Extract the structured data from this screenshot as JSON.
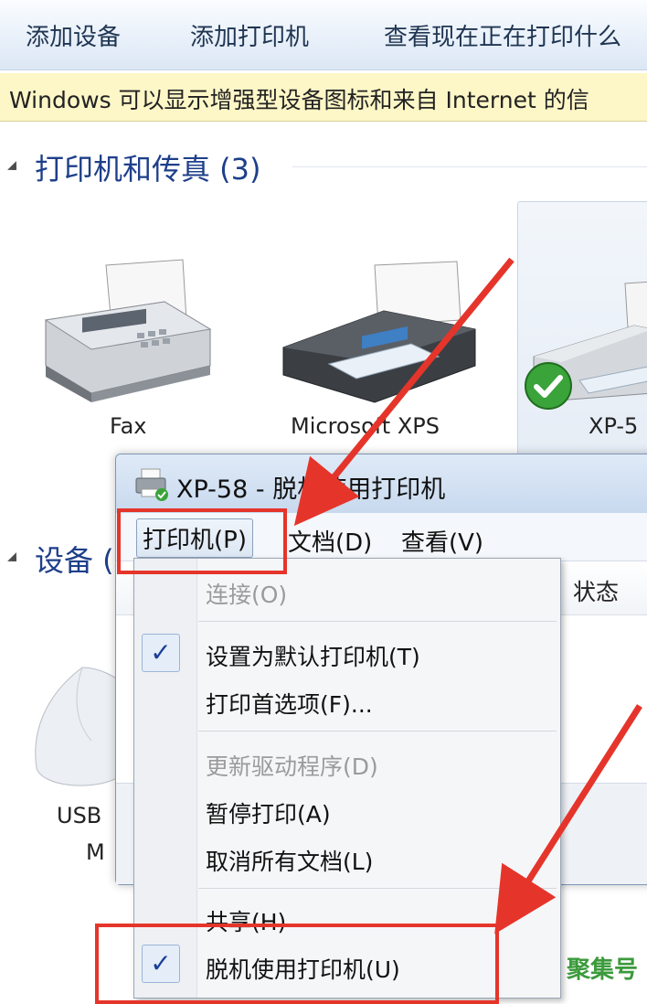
{
  "toolbar": {
    "add_device": "添加设备",
    "add_printer": "添加打印机",
    "see_printing": "查看现在正在打印什么"
  },
  "infobar": {
    "text": "Windows 可以显示增强型设备图标和来自 Internet 的信"
  },
  "printers_group": {
    "title": "打印机和传真 (3)",
    "devices": [
      {
        "label": "Fax",
        "icon": "fax-icon"
      },
      {
        "label": "Microsoft XPS",
        "icon": "printer-icon"
      },
      {
        "label": "XP-5",
        "icon": "printer-default-icon"
      }
    ]
  },
  "devices_group": {
    "title": "设备 (",
    "usb_label_1": "USB",
    "usb_label_2": "M"
  },
  "dialog": {
    "title": "XP-58  -  脱机使用打印机",
    "menu": {
      "printer": "打印机(P)",
      "document": "文档(D)",
      "view": "查看(V)"
    },
    "column_status": "状态"
  },
  "dropdown": {
    "items": [
      {
        "label": "连接(O)",
        "enabled": false,
        "checked": false
      },
      {
        "label": "设置为默认打印机(T)",
        "enabled": true,
        "checked": true
      },
      {
        "label": "打印首选项(F)...",
        "enabled": true,
        "checked": false
      },
      {
        "label": "更新驱动程序(D)",
        "enabled": false,
        "checked": false
      },
      {
        "label": "暂停打印(A)",
        "enabled": true,
        "checked": false
      },
      {
        "label": "取消所有文档(L)",
        "enabled": true,
        "checked": false
      },
      {
        "label": "共享(H)",
        "enabled": true,
        "checked": false
      },
      {
        "label": "脱机使用打印机(U)",
        "enabled": true,
        "checked": true
      }
    ]
  },
  "watermark": "聚集号",
  "colors": {
    "annotation_red": "#e5352b",
    "group_title_blue": "#1e3f8a",
    "default_check_green": "#3aa33a"
  }
}
